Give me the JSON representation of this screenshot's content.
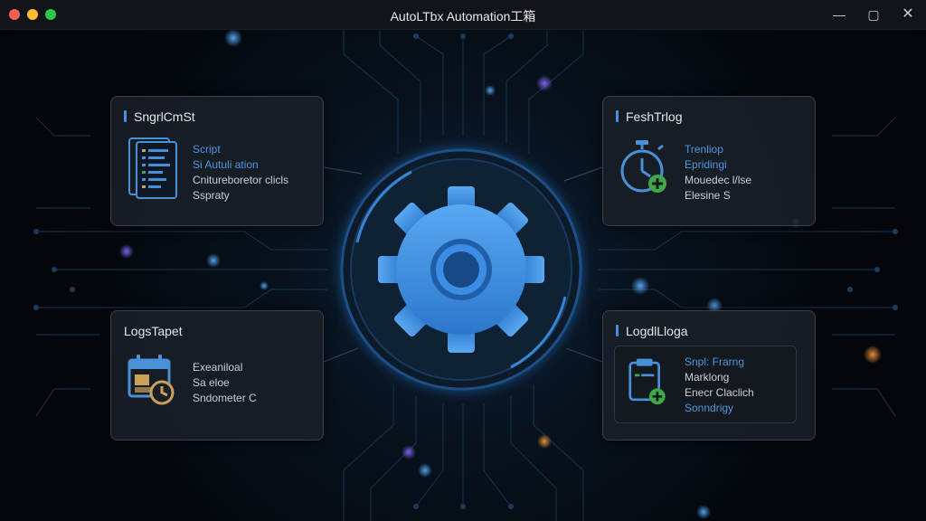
{
  "window": {
    "title": "AutoLTbx Automation工箱"
  },
  "cards": {
    "top_left": {
      "title": "SngrlCmSt",
      "icon": "script-document-icon",
      "lines": [
        "Script",
        "Si Autuli ation",
        "Cnitureboretor clicls",
        "Sspraty"
      ]
    },
    "top_right": {
      "title": "FeshTrlog",
      "icon": "stopwatch-icon",
      "lines": [
        "Trenliop",
        "Epridingi",
        "Mouedec l/lse",
        "Elesine S"
      ]
    },
    "bottom_left": {
      "title": "LogsTapet",
      "icon": "calendar-clock-icon",
      "lines": [
        "Exeaniloal",
        "Sa eloe",
        "Sndometer C"
      ]
    },
    "bottom_right": {
      "title": "LogdlLloga",
      "icon": "clipboard-add-icon",
      "lines": [
        "Snpl: Frarng",
        "Marklong",
        "Enecr Claclich",
        "Sonndrigy"
      ]
    }
  },
  "colors": {
    "accent": "#4a90d9",
    "gear": "#3f8de0",
    "success": "#3ea84a",
    "clock_gold": "#c9a15a"
  }
}
